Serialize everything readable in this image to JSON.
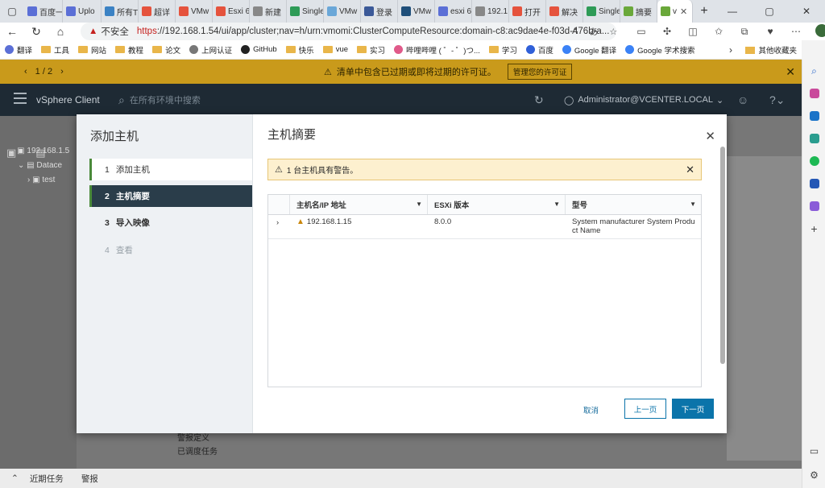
{
  "browser": {
    "tabs": [
      {
        "label": "百度一",
        "color": "#5b6fd6"
      },
      {
        "label": "Uplo",
        "color": "#5b6fd6"
      },
      {
        "label": "所有T",
        "color": "#3b82c4"
      },
      {
        "label": "超详",
        "color": "#e5533d"
      },
      {
        "label": "VMw",
        "color": "#e5533d"
      },
      {
        "label": "Esxi 6",
        "color": "#e5533d"
      },
      {
        "label": "新建",
        "color": "#888888"
      },
      {
        "label": "Single",
        "color": "#2e9b57"
      },
      {
        "label": "VMw",
        "color": "#6aa7d8"
      },
      {
        "label": "登录",
        "color": "#3b5998"
      },
      {
        "label": "VMw",
        "color": "#1f4f7a"
      },
      {
        "label": "esxi 6",
        "color": "#5b6fd6"
      },
      {
        "label": "192.1",
        "color": "#888888"
      },
      {
        "label": "打开",
        "color": "#e5533d"
      },
      {
        "label": "解决",
        "color": "#e5533d"
      },
      {
        "label": "Single",
        "color": "#2e9b57"
      },
      {
        "label": "摘要",
        "color": "#6aa83a"
      },
      {
        "label": "v",
        "color": "#6aa83a"
      }
    ],
    "address": {
      "insecure_label": "不安全",
      "https": "https",
      "rest": "://192.168.1.54/ui/app/cluster;nav=h/urn:vmomi:ClusterComputeResource:domain-c8:ac9dae4e-f03d-476b-a..."
    },
    "bookmarks": [
      "翻译",
      "工具",
      "网站",
      "教程",
      "论文",
      "上网认证",
      "GitHub",
      "快乐",
      "vue",
      "实习",
      "哔哩哔哩 ( ゜- ゜)つ...",
      "学习",
      "百度",
      "Google 翻译",
      "Google 学术搜索"
    ],
    "other_bookmarks": "其他收藏夹"
  },
  "app": {
    "license_bar": {
      "pager": "1 / 2",
      "message": "清单中包含已过期或即将过期的许可证。",
      "manage_button": "管理您的许可证"
    },
    "header": {
      "brand": "vSphere Client",
      "search_placeholder": "在所有环境中搜索",
      "user": "Administrator@VCENTER.LOCAL"
    },
    "tree": [
      "192.168.1.5",
      "Datace",
      "test"
    ],
    "mid_text": [
      "警报定义",
      "已调度任务"
    ],
    "bottom_bar": {
      "recent_tasks": "近期任务",
      "alarms": "警报"
    }
  },
  "dialog": {
    "title": "添加主机",
    "steps": [
      {
        "num": "1",
        "label": "添加主机"
      },
      {
        "num": "2",
        "label": "主机摘要"
      },
      {
        "num": "3",
        "label": "导入映像"
      },
      {
        "num": "4",
        "label": "查看"
      }
    ],
    "main_title": "主机摘要",
    "alert": "1 台主机具有警告。",
    "grid": {
      "columns": [
        "主机名/IP 地址",
        "ESXi 版本",
        "型号"
      ],
      "rows": [
        {
          "host": "192.168.1.15",
          "version": "8.0.0",
          "model": "System manufacturer System Product Name"
        }
      ]
    },
    "buttons": {
      "cancel": "取消",
      "prev": "上一页",
      "next": "下一页"
    }
  }
}
